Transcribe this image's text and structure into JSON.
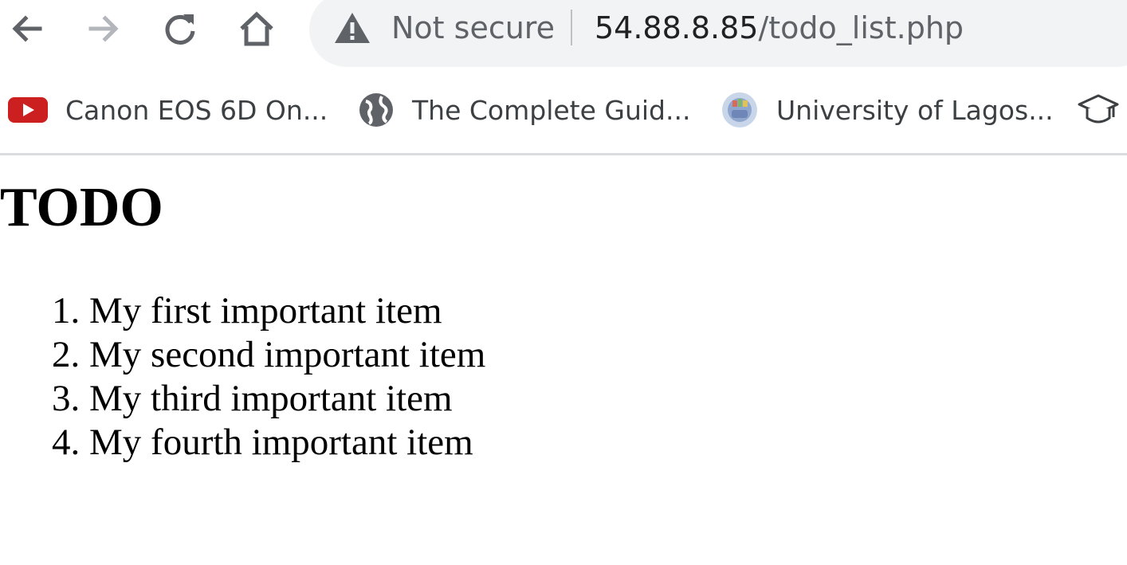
{
  "browser": {
    "nav": {
      "back_icon": "arrow-left-icon",
      "forward_icon": "arrow-right-icon",
      "reload_icon": "reload-icon",
      "home_icon": "home-icon"
    },
    "omnibox": {
      "security_icon": "warning-triangle-icon",
      "security_text": "Not secure",
      "url_host": "54.88.8.85",
      "url_path": "/todo_list.php",
      "background": "#f1f3f4"
    },
    "bookmarks": [
      {
        "icon": "youtube-icon",
        "label": "Canon EOS 6D On..."
      },
      {
        "icon": "globe-icon",
        "label": "The Complete Guid..."
      },
      {
        "icon": "university-icon",
        "label": "University of Lagos..."
      },
      {
        "icon": "graduation-cap-icon",
        "label": ""
      }
    ]
  },
  "page": {
    "heading": "TODO",
    "items": [
      "My first important item",
      "My second important item",
      "My third important item",
      "My fourth important item"
    ]
  },
  "colors": {
    "youtube_red": "#cc1f1f",
    "text_dark": "#202124",
    "text_gray": "#5f6368"
  }
}
